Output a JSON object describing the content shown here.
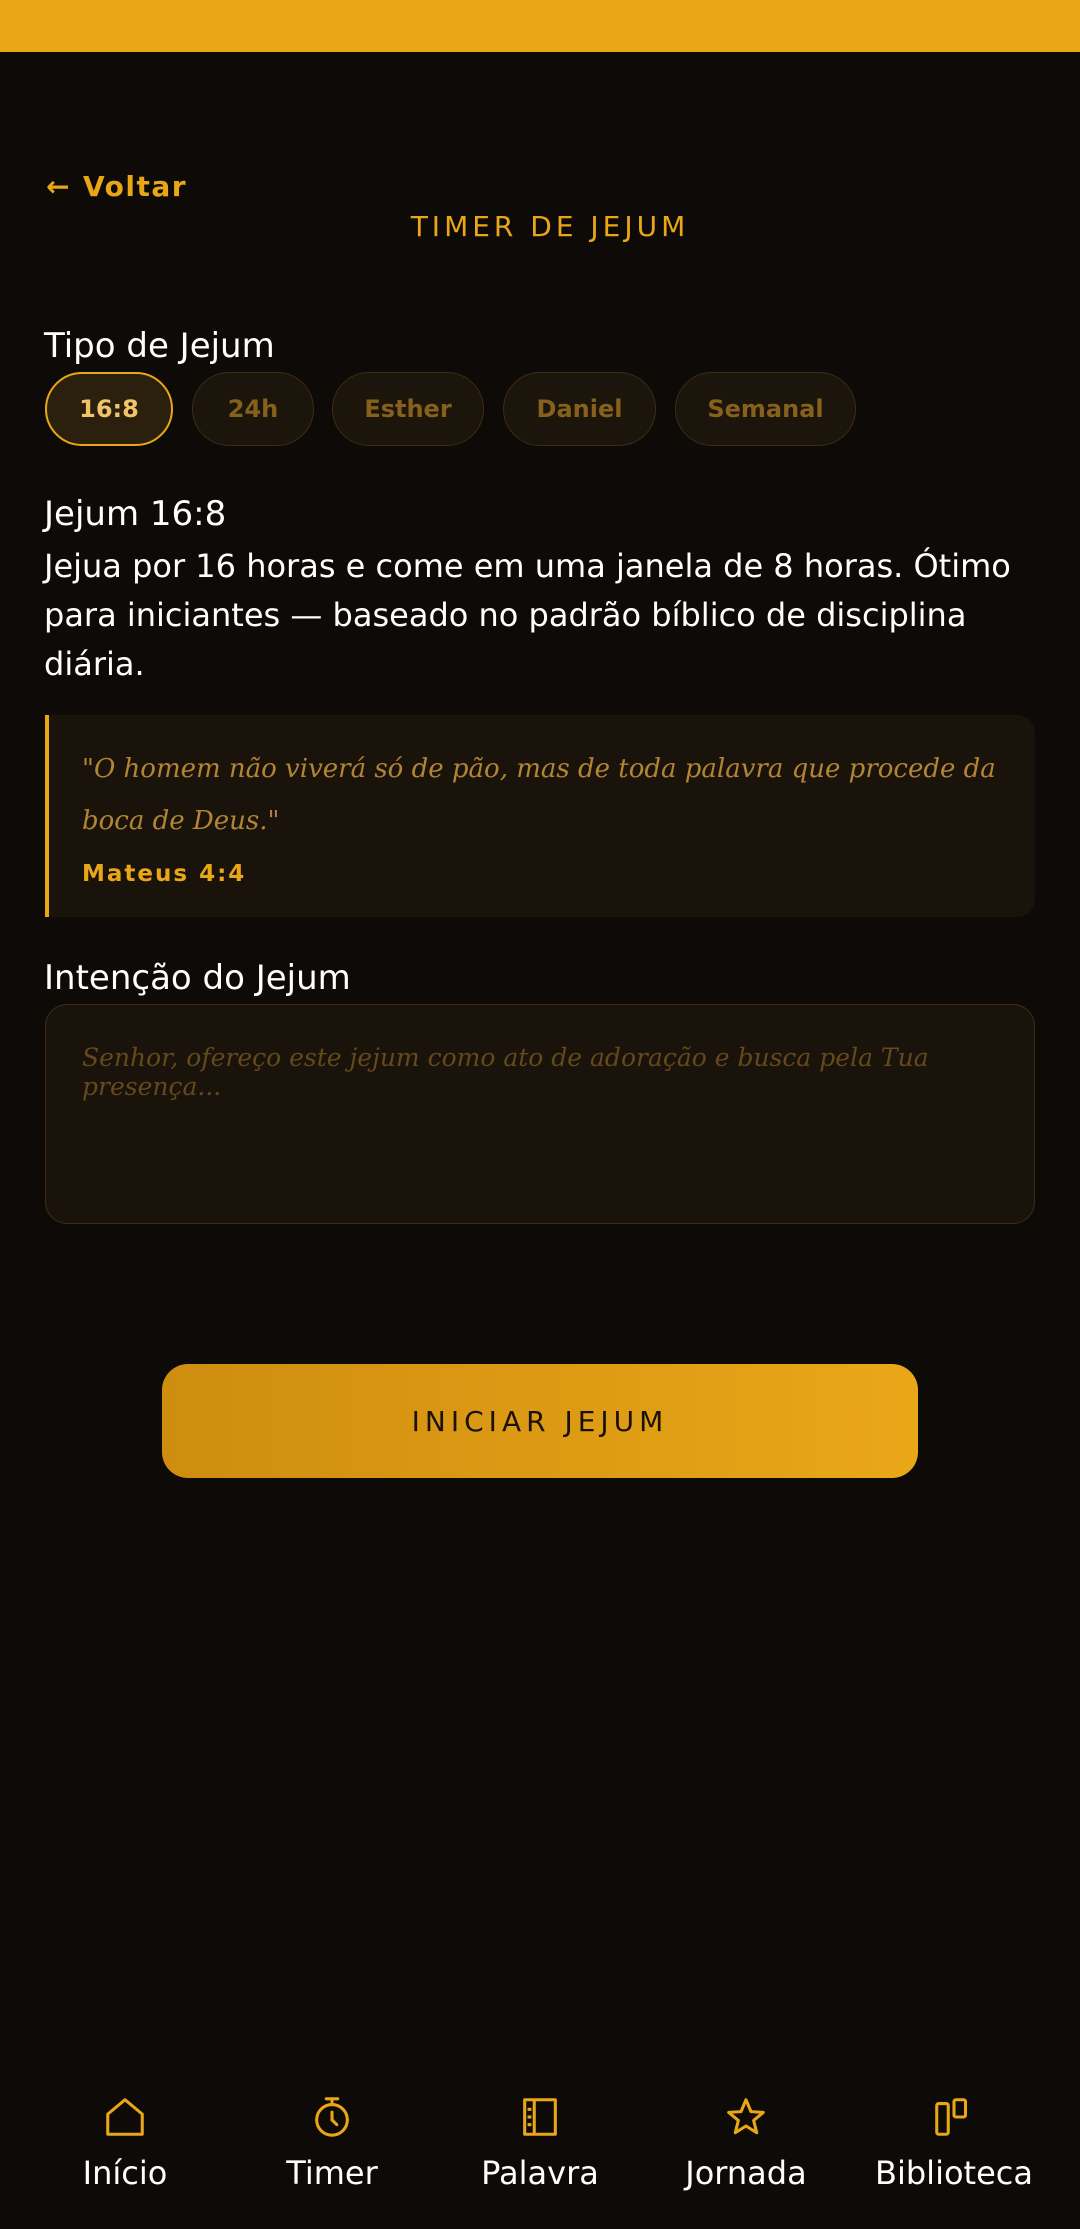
{
  "header": {
    "back_label": "Voltar",
    "back_arrow": "←",
    "title": "TIMER DE JEJUM"
  },
  "fast_type": {
    "label": "Tipo de Jejum",
    "options": [
      "16:8",
      "24h",
      "Esther",
      "Daniel",
      "Semanal"
    ],
    "selected": "16:8"
  },
  "description": {
    "title": "Jejum 16:8",
    "text": "Jejua por 16 horas e come em uma janela de 8 horas. Ótimo para iniciantes — baseado no padrão bíblico de disciplina diária."
  },
  "verse": {
    "text": "\"O homem não viverá só de pão, mas de toda palavra que procede da boca de Deus.\"",
    "reference": "Mateus 4:4"
  },
  "intention": {
    "label": "Intenção do Jejum",
    "placeholder": "Senhor, ofereço este jejum como ato de adoração e busca pela Tua presença...",
    "value": ""
  },
  "actions": {
    "start_label": "INICIAR JEJUM"
  },
  "nav": {
    "items": [
      {
        "label": "Início",
        "icon": "home-icon"
      },
      {
        "label": "Timer",
        "icon": "timer-icon"
      },
      {
        "label": "Palavra",
        "icon": "book-icon"
      },
      {
        "label": "Jornada",
        "icon": "star-icon"
      },
      {
        "label": "Biblioteca",
        "icon": "library-icon"
      }
    ]
  },
  "colors": {
    "accent": "#e9a718",
    "background": "#0d0a07",
    "card": "#1a130c"
  }
}
